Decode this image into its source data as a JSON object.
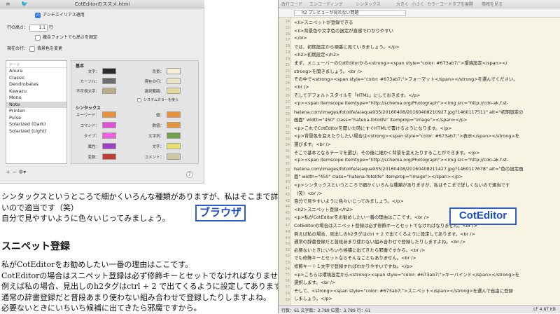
{
  "pref": {
    "window_title": "CotEditorのススメ.html",
    "antialias_label": "アンチエイリアス適用",
    "line_height_label": "行の高さ：",
    "line_height_value": "1.1",
    "line_height_unit": "行",
    "compound_font_label": "複合フォントでも高さを固定",
    "current_line_label": "現在の行：",
    "bg_change_label": "背景色を変更",
    "theme_header": "テーマ",
    "themes": [
      "Anura",
      "Classic",
      "Dendrobates",
      "Kawazu",
      "Mono",
      "Note",
      "Printen",
      "Pulse",
      "Solarized (Dark)",
      "Solarized (Light)"
    ],
    "selected_theme": "Note",
    "basic_header": "基本",
    "syntax_header": "シンタックス",
    "system_color_label": "システムカラーを使う",
    "basic_left": [
      {
        "label": "文字：",
        "color": "#2a2a2a"
      },
      {
        "label": "カーソル：",
        "color": "#6d6d6d"
      },
      {
        "label": "不可視文字：",
        "color": "#b9b08a"
      }
    ],
    "basic_right": [
      {
        "label": "背景：",
        "color": "#f6f1d6"
      },
      {
        "label": "現在の行：",
        "color": "#ece6c6"
      },
      {
        "label": "選択範囲：",
        "color": "#e4d798"
      }
    ],
    "syntax_left": [
      {
        "label": "キーワード：",
        "color": "#e8923a"
      },
      {
        "label": "コマンド：",
        "color": "#df4fd8"
      },
      {
        "label": "タイプ：",
        "color": "#ec5fe2"
      },
      {
        "label": "属性：",
        "color": "#9b3fc6"
      },
      {
        "label": "変数：",
        "color": "#c23a34"
      }
    ],
    "syntax_right": [
      {
        "label": "値：",
        "color": "#e8923a"
      },
      {
        "label": "数値：",
        "color": "#e3963c"
      },
      {
        "label": "文字列：",
        "color": "#6fa24a"
      },
      {
        "label": "文字：",
        "color": "#e6dd6a"
      },
      {
        "label": "コメント：",
        "color": "#cfc5a0"
      }
    ],
    "list_buttons": "+  −  ✲▾",
    "help_label": "?"
  },
  "doc": {
    "para1_line1": "シンタックスというところで細かくいろんな種類がありますが、私はそこまで詳しくな",
    "para1_line2": "いので適当です（笑）",
    "para1_line3": "自分で見やすいように色々いじってみましょう。",
    "heading": "スニペット登録",
    "para2": [
      "私がCotEditorをお勧めしたい一番の理由はここです。",
      "CotEditorの場合はスニペット登録は必ず修飾キーとセットでなければなりません。",
      "例えば私の場合、見出しのh2タグはctrl + 2 で出てくるように設定してあります。",
      "通常の辞書登録だと普段あまり使わない組み合わせで登録したりしますよね。",
      "必要ないときにいちいち候補に出てきたら邪魔ですから。"
    ],
    "stamp": "ブラウザ"
  },
  "editor": {
    "toolbar": [
      "改行コード",
      "エンコーディング",
      "シンタックス",
      "大きく",
      "小さく",
      "カラーコード",
      "タブを展開",
      "情報を見る"
    ],
    "tab_title": "h2 プレビューが見れない問題",
    "stamp": "CotEditor",
    "line_numbers": [
      "14",
      "15",
      "16",
      "17",
      "18",
      "19",
      "20",
      "21",
      "22",
      "23",
      "24",
      "25",
      "26",
      "27",
      "28",
      "29",
      "30",
      "31",
      "32",
      "33",
      "34",
      "35",
      "36",
      "37",
      "38",
      "39",
      "40",
      "41",
      "42",
      "43",
      "44",
      "45",
      "46",
      "47",
      "48",
      "49",
      "50",
      "51",
      "52",
      "53",
      "54",
      "55",
      "56",
      "57",
      "58",
      "59"
    ],
    "code_lines": [
      "<li>スニペットが登録できる",
      "<li>背景色や文字色の設定が直感でわかりやすい",
      "</ol>",
      "では、初期設定から順番に見ていきましょう。</p>",
      "<h2>初期設定</h2>",
      "まず、メニューバーのCotEditorから<strong><span style=\"color: #673ab7;\">環境設定</span></",
      "strong>を開きましょう。<br />",
      "その中で<strong><span style=\"color: #673ab7;\">フォーマット</span></strong>を選んでください。",
      "<br />",
      "そしてデフォルトスタイルを「HTML」にしておきます。</p>",
      "<p><span itemscope itemtype=\"http://schema.org/Photograph\"><img src=\"http://cdn-ak.f.st-",
      "hatena.com/images/fotolife/a/aqua935/20160408/20160408210927.jpg?1460117511\" alt=\"初期設定の",
      "画面\" width=\"450\" class=\"hatena-fotolife\" itemprop=\"image\"></span></p>",
      "<p>これでCotEditorを開いた時にすぐHTMLで書けるようになります。</p>",
      "<p>背景色を変えたりしたい場合は<strong><span style=\"color: #673ab7;\">表示</span></strong>を",
      "選びます。<br />",
      "そこで基本となるテーマを選び、その後に細かく背景を変えたりすることができます。</p>",
      "<p><span itemscope itemtype=\"http://schema.org/Photograph\"><img src=\"http://cdn-ak.f.st-",
      "hatena.com/images/fotolife/a/aqua935/20160408/20160408211427.jpg?1460117678\" alt=\"色の設定画",
      "面\" width=\"450\" class=\"hatena-fotolife\" itemprop=\"image\"></span></p>",
      "<p>シンタックスというところで細かくいろんな種類がありますが、私はそこまで詳しくないので適当です",
      "（笑）<br />",
      "自分で見やすいように色々いじってみましょう。</p>",
      "<h2>スニペット登録</h2>",
      "<p>私がCotEditorをお勧めしたい一番の理由はここです。<br />",
      "CotEditorの場合はスニペット登録は必ず修飾キーとセットでなければなりません。<br />",
      "例えば私の場合、見出しのh2タグはctrl + 2 で出てくるように設定してあります。<br />",
      "通常の辞書登録だと普段あまり使わない組み合わせで登録したりしますよね。<br />",
      "必要ないときにいちいち候補に出てきたら邪魔ですから。<br />",
      "でも修飾キーとセットならそんなこともありません。<br />",
      "修飾キー＋１文字で登録すればわかりやすいですね。</p>",
      "<p>こちらは環境設定から<strong><span style=\"color: #673ab7;\">キーバインド</span></strong>を",
      "選択します。<br />",
      "そして、<strong><span style=\"color: #673ab7;\">スニペット</span></strong>を選んで自由に登録",
      "しましょう。</p>"
    ],
    "status_left": "行数：61  文字数：3,789  位置：3,789  行：61",
    "status_right": "LF   4.87 KB"
  }
}
